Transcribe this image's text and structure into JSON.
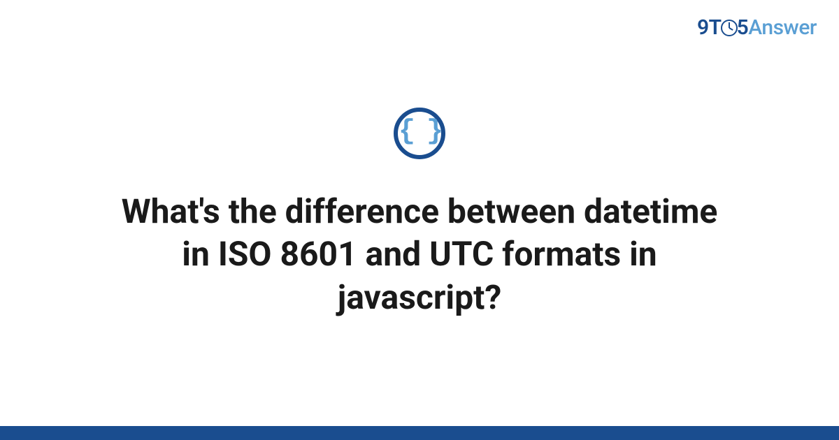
{
  "logo": {
    "part1": "9T",
    "part2": "5",
    "part3": "Answer"
  },
  "icon": {
    "name": "code-braces-icon",
    "glyph": "{ }"
  },
  "question": {
    "title": "What's the difference between datetime in ISO 8601 and UTC formats in javascript?"
  },
  "colors": {
    "brand_dark": "#1a4d8f",
    "brand_light": "#5a9fd4"
  }
}
